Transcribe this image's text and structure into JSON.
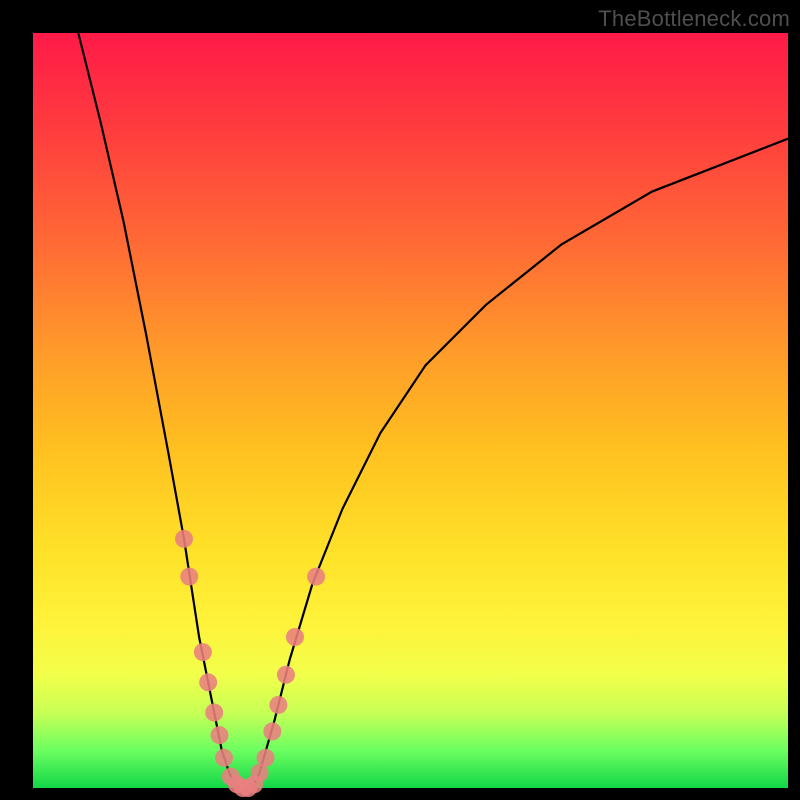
{
  "watermark": "TheBottleneck.com",
  "chart_data": {
    "type": "line",
    "title": "",
    "xlabel": "",
    "ylabel": "",
    "xlim": [
      0,
      100
    ],
    "ylim": [
      0,
      100
    ],
    "grid": false,
    "legend": false,
    "gradient_scale": {
      "description": "Background hue band; green ≈ balanced, yellow ≈ mild, red ≈ severe bottleneck",
      "stops": [
        {
          "pos": 0,
          "color": "#ff1a48"
        },
        {
          "pos": 50,
          "color": "#ffc020"
        },
        {
          "pos": 80,
          "color": "#fff23a"
        },
        {
          "pos": 100,
          "color": "#12d648"
        }
      ]
    },
    "series": [
      {
        "name": "bottleneck-curve",
        "stroke": "#000000",
        "points": [
          {
            "x": 6,
            "y": 100
          },
          {
            "x": 9,
            "y": 88
          },
          {
            "x": 12,
            "y": 75
          },
          {
            "x": 15,
            "y": 60
          },
          {
            "x": 18,
            "y": 44
          },
          {
            "x": 20,
            "y": 33
          },
          {
            "x": 22,
            "y": 20
          },
          {
            "x": 24,
            "y": 10
          },
          {
            "x": 25,
            "y": 5
          },
          {
            "x": 26,
            "y": 2
          },
          {
            "x": 27,
            "y": 0
          },
          {
            "x": 29,
            "y": 0
          },
          {
            "x": 30,
            "y": 2
          },
          {
            "x": 32,
            "y": 9
          },
          {
            "x": 34,
            "y": 17
          },
          {
            "x": 37,
            "y": 27
          },
          {
            "x": 41,
            "y": 37
          },
          {
            "x": 46,
            "y": 47
          },
          {
            "x": 52,
            "y": 56
          },
          {
            "x": 60,
            "y": 64
          },
          {
            "x": 70,
            "y": 72
          },
          {
            "x": 82,
            "y": 79
          },
          {
            "x": 100,
            "y": 86
          }
        ]
      },
      {
        "name": "sample-markers",
        "marker_color": "#e9807f",
        "points": [
          {
            "x": 20.0,
            "y": 33
          },
          {
            "x": 20.7,
            "y": 28
          },
          {
            "x": 22.5,
            "y": 18
          },
          {
            "x": 23.2,
            "y": 14
          },
          {
            "x": 24.0,
            "y": 10
          },
          {
            "x": 24.7,
            "y": 7
          },
          {
            "x": 25.3,
            "y": 4
          },
          {
            "x": 26.2,
            "y": 1.5
          },
          {
            "x": 27.0,
            "y": 0.5
          },
          {
            "x": 27.8,
            "y": 0
          },
          {
            "x": 28.5,
            "y": 0
          },
          {
            "x": 29.3,
            "y": 0.5
          },
          {
            "x": 30.0,
            "y": 2
          },
          {
            "x": 30.8,
            "y": 4
          },
          {
            "x": 31.7,
            "y": 7.5
          },
          {
            "x": 32.5,
            "y": 11
          },
          {
            "x": 33.5,
            "y": 15
          },
          {
            "x": 34.7,
            "y": 20
          },
          {
            "x": 37.5,
            "y": 28
          }
        ]
      }
    ]
  }
}
